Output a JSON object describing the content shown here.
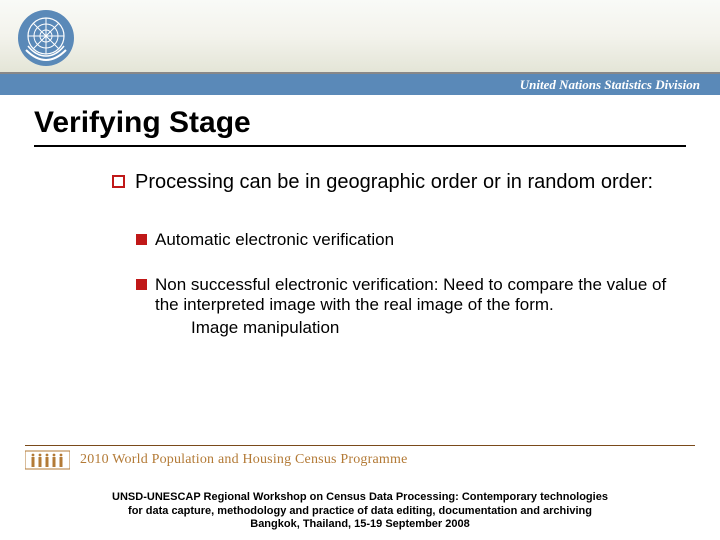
{
  "header": {
    "org_label": "United Nations Statistics Division"
  },
  "title": "Verifying Stage",
  "bullets": {
    "main": "Processing can be in geographic order or in random order:",
    "sub1": "Automatic electronic verification",
    "sub2": "Non successful electronic verification: Need to compare the value of the interpreted image with the real image of the form.",
    "sub2_extra": "Image manipulation"
  },
  "programme": {
    "text": "2010 World Population and Housing Census Programme"
  },
  "footer": {
    "line1": "UNSD-UNESCAP Regional Workshop on Census Data Processing: Contemporary technologies",
    "line2": "for data capture, methodology and practice of data editing, documentation and archiving",
    "line3": "Bangkok, Thailand, 15-19 September 2008"
  }
}
